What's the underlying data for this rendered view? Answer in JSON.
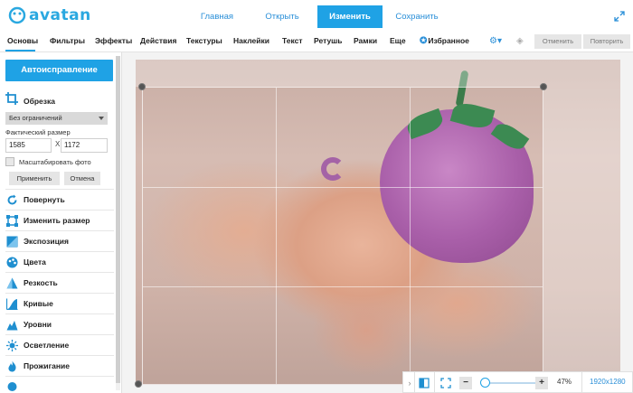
{
  "header": {
    "logo_text": "avatan",
    "nav": [
      {
        "label": "Главная",
        "active": false
      },
      {
        "label": "Открыть",
        "active": false
      },
      {
        "label": "Изменить",
        "active": true
      },
      {
        "label": "Сохранить",
        "active": false
      }
    ],
    "expand_icon": "expand-icon"
  },
  "tabs": {
    "items": [
      "Основы",
      "Фильтры",
      "Эффекты",
      "Действия",
      "Текстуры",
      "Наклейки",
      "Текст",
      "Ретушь",
      "Рамки",
      "Еще",
      "Избранное"
    ],
    "active": "Основы",
    "undo_label": "Отменить",
    "redo_label": "Повторить"
  },
  "sidebar": {
    "autofix_label": "Автоисправление",
    "crop": {
      "title": "Обрезка",
      "ratio_selected": "Без ограничений",
      "size_label": "Фактический размер",
      "width": "1585",
      "separator": "X",
      "height": "1172",
      "scale_label": "Масштабировать фото",
      "apply_label": "Применить",
      "cancel_label": "Отмена"
    },
    "tools": [
      {
        "label": "Повернуть",
        "icon": "rotate-icon"
      },
      {
        "label": "Изменить размер",
        "icon": "resize-icon"
      },
      {
        "label": "Экспозиция",
        "icon": "exposure-icon"
      },
      {
        "label": "Цвета",
        "icon": "palette-icon"
      },
      {
        "label": "Резкость",
        "icon": "sharpness-icon"
      },
      {
        "label": "Кривые",
        "icon": "curves-icon"
      },
      {
        "label": "Уровни",
        "icon": "levels-icon"
      },
      {
        "label": "Осветление",
        "icon": "brighten-icon"
      },
      {
        "label": "Прожигание",
        "icon": "burn-icon"
      }
    ]
  },
  "bottom": {
    "zoom_out": "−",
    "zoom_in": "+",
    "zoom_percent": "47%",
    "image_size": "1920x1280",
    "zoom_level": 0.47
  },
  "colors": {
    "accent": "#1fa2e5",
    "link": "#2a8fd8"
  }
}
